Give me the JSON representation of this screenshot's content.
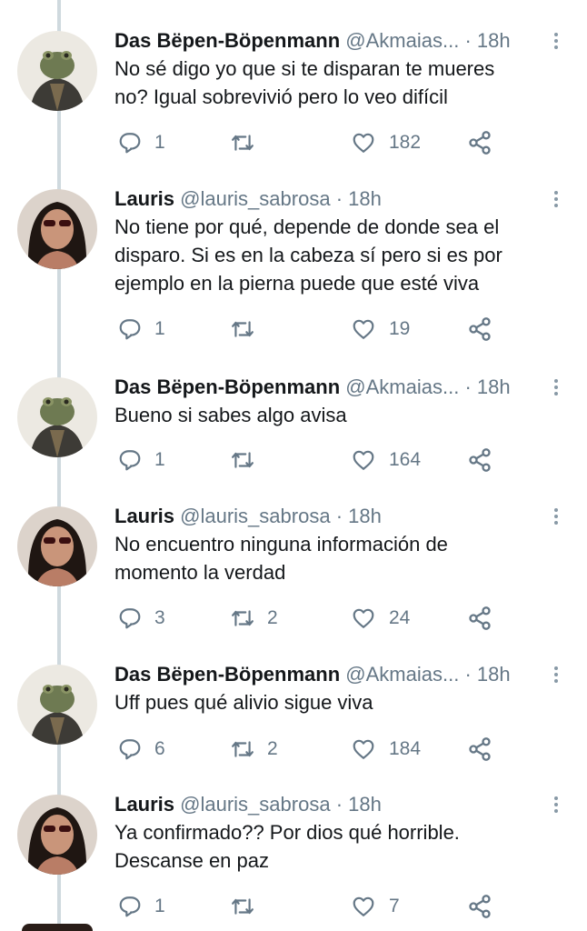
{
  "tweets": [
    {
      "avatar": "frog-avatar",
      "name": "Das Bëpen-Böpenmann",
      "handle": "@Akmaias...",
      "time": "· 18h",
      "lines": [
        "No sé digo yo que si te disparan te mueres",
        "no? Igual sobrevivió pero lo veo difícil"
      ],
      "replies": "1",
      "retweets": "",
      "likes": "182"
    },
    {
      "avatar": "woman-sunglasses-avatar",
      "name": "Lauris",
      "handle": "@lauris_sabrosa",
      "time": "· 18h",
      "lines": [
        "No tiene por qué, depende de donde sea el",
        "disparo. Si es en la cabeza sí pero si es por",
        "ejemplo en la pierna puede que esté viva"
      ],
      "replies": "1",
      "retweets": "",
      "likes": "19"
    },
    {
      "avatar": "frog-avatar",
      "name": "Das Bëpen-Böpenmann",
      "handle": "@Akmaias...",
      "time": "· 18h",
      "lines": [
        "Bueno si sabes algo avisa"
      ],
      "replies": "1",
      "retweets": "",
      "likes": "164"
    },
    {
      "avatar": "woman-sunglasses-avatar",
      "name": "Lauris",
      "handle": "@lauris_sabrosa",
      "time": "· 18h",
      "lines": [
        "No encuentro ninguna información de",
        "momento la verdad"
      ],
      "replies": "3",
      "retweets": "2",
      "likes": "24"
    },
    {
      "avatar": "frog-avatar",
      "name": "Das Bëpen-Böpenmann",
      "handle": "@Akmaias...",
      "time": "· 18h",
      "lines": [
        "Uff pues qué alivio sigue viva"
      ],
      "replies": "6",
      "retweets": "2",
      "likes": "184"
    },
    {
      "avatar": "woman-sunglasses-avatar",
      "name": "Lauris",
      "handle": "@lauris_sabrosa",
      "time": "· 18h",
      "lines": [
        "Ya confirmado?? Por dios qué horrible.",
        "Descanse en paz"
      ],
      "replies": "1",
      "retweets": "",
      "likes": "7"
    }
  ],
  "icons": {
    "reply": "reply-icon",
    "retweet": "retweet-icon",
    "like": "heart-icon",
    "share": "share-icon",
    "menu": "more-options-icon"
  },
  "colors": {
    "text": "#14171a",
    "secondary": "#657786",
    "thread_line": "#cfd9de"
  }
}
